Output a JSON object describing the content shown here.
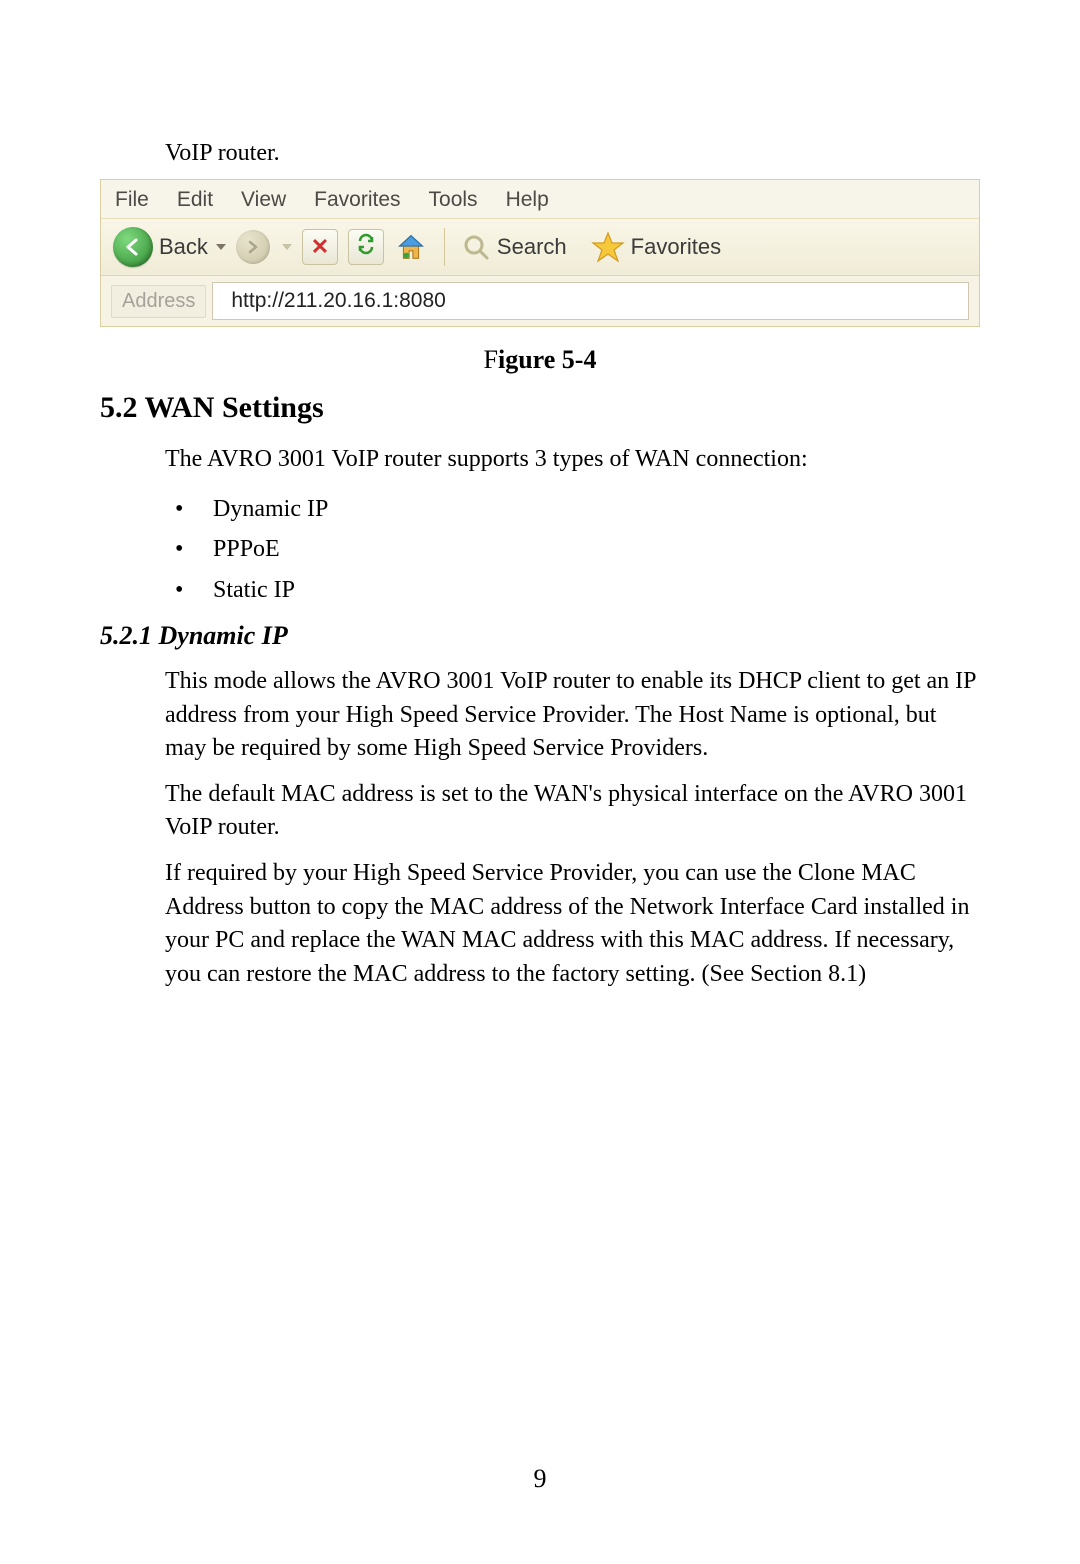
{
  "intro_line": "VoIP router.",
  "browser": {
    "menu": {
      "file": "File",
      "edit": "Edit",
      "view": "View",
      "favorites": "Favorites",
      "tools": "Tools",
      "help": "Help"
    },
    "toolbar": {
      "back_label": "Back",
      "search_label": "Search",
      "favorites_label": "Favorites"
    },
    "address_label": "Address",
    "address_value": "http://211.20.16.1:8080"
  },
  "figure_caption": {
    "letter": "F",
    "rest": "igure 5-4"
  },
  "section_heading": "5.2 WAN Settings",
  "wan_intro": "The AVRO 3001 VoIP router supports 3 types of WAN connection:",
  "wan_types": [
    "Dynamic IP",
    "PPPoE",
    "Static IP"
  ],
  "subsection_heading": "5.2.1 Dynamic IP",
  "dyn_p1": "This mode allows the AVRO 3001 VoIP router to enable its DHCP client to get an IP address from your High Speed Service Provider. The Host Name is optional, but may be required by some High Speed Service Providers.",
  "dyn_p2": "The default MAC address is set to the WAN's physical interface on the AVRO 3001 VoIP router.",
  "dyn_p3": "If required by your High Speed Service Provider, you can use the Clone MAC Address button to copy the MAC address of the Network Interface Card installed in your PC and replace the WAN MAC address with this MAC address. If necessary, you can restore the MAC address to the factory setting. (See Section 8.1)",
  "page_number": "9"
}
